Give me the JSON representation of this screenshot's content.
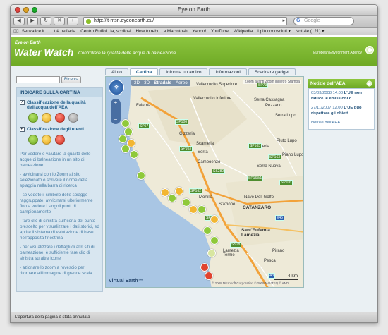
{
  "window": {
    "title": "Eye on Earth"
  },
  "toolbar": {
    "back": "◀",
    "forward": "▶",
    "reload": "↻",
    "stop": "✕",
    "add": "+",
    "url": "http://it-msn.eyeonearth.eu/",
    "search_placeholder": "Google"
  },
  "bookmarks": [
    "Senzalice.it",
    "... t è nell'aria",
    "Centro Ruffol...ia, scoliosi",
    "How to rebu...a Macintosh",
    "Yahoo!",
    "YouTube",
    "Wikipedia",
    "I più conosciuti ▾",
    "Notizie (121) ▾"
  ],
  "header": {
    "eyebrow": "Eye on Earth",
    "title": "Water Watch",
    "subtitle": "Controllare la qualità delle acque di balneazione",
    "agency": "European Environment Agency"
  },
  "tabs": [
    {
      "label": "Aiuto",
      "active": false
    },
    {
      "label": "Cartina",
      "active": true
    },
    {
      "label": "Informa un amico",
      "active": false
    },
    {
      "label": "Informazioni",
      "active": false
    },
    {
      "label": "Scaricare gadget",
      "active": false
    }
  ],
  "search": {
    "button": "Ricerca",
    "value": ""
  },
  "sidebar": {
    "heading": "INDICARE SULLA CARTINA",
    "check1": "Classificazione della qualità dell'acqua dell'AEA",
    "check2": "Classificazione degli utenti",
    "help": [
      "Per vedere e valutare la qualità delle acque di balneazione in un sito di balneazione:",
      "- avvicinarsi con lo Zoom al sito selezionato o scrivere il nome della spiaggia nella barra di ricerca",
      "- se vedete il simbolo delle spiagge raggruppate, avvicinarsi ulteriormente fino a vedere i singoli punti di campionamento",
      "- fare clic di sinistra sull'icona del punto prescelto per visualizzare i dati storici, ed aprire il sistema di valutazione di base nell'apposita finestrina",
      "- per visualizzare i dettagli di altri siti di balneazione, è sufficiente fare clic di sinistra su altre icone",
      "- azionare lo zoom a rovescio per ritornare all'immagine di grande scala"
    ]
  },
  "map": {
    "modes": [
      "2D",
      "3D",
      "Stradale",
      "Aereo"
    ],
    "selected_mode": "Stradale",
    "tiny_links": "Zoom avanti  Zoom indietro  Stampa",
    "labels": [
      {
        "text": "Falerna",
        "big": false
      },
      {
        "text": "Vallecrucito Superiore",
        "big": false
      },
      {
        "text": "Vallecrucito Inferiore",
        "big": false
      },
      {
        "text": "Serra Cassagna",
        "big": false
      },
      {
        "text": "Pezzano",
        "big": false
      },
      {
        "text": "Gizzeria",
        "big": false
      },
      {
        "text": "Scarnella",
        "big": false
      },
      {
        "text": "Serra",
        "big": false
      },
      {
        "text": "Seria",
        "big": false
      },
      {
        "text": "Campoenzo",
        "big": false
      },
      {
        "text": "Serra Nuova",
        "big": false
      },
      {
        "text": "Mortilla",
        "big": false
      },
      {
        "text": "Stazione",
        "big": false
      },
      {
        "text": "Nave Dell Golfo",
        "big": false
      },
      {
        "text": "CATANZARO",
        "big": true
      },
      {
        "text": "Sant'Eufemia Lamezia",
        "big": true
      },
      {
        "text": "Lamezia Terme",
        "big": false
      },
      {
        "text": "Pesca",
        "big": false
      },
      {
        "text": "Pirano",
        "big": false
      },
      {
        "text": "Pluto Lupo",
        "big": false
      },
      {
        "text": "Serra Lupo",
        "big": false
      },
      {
        "text": "Piano Lupo",
        "big": false
      }
    ],
    "roads": [
      "SP57",
      "SP73",
      "SP106",
      "SP103",
      "SP103",
      "SP163",
      "SS280",
      "SP163/1",
      "SP162",
      "SP106",
      "SP160",
      "SS18",
      "E45",
      "A3"
    ],
    "scale": "4 km",
    "brand": "Virtual Earth™",
    "copyright": "© 2008 Microsoft Corporation   © 2008 NAVTEQ   © AND"
  },
  "news": {
    "heading": "Notizie dell'AEA",
    "items": [
      {
        "date": "03/03/2008 14.00",
        "title": "L'UE non riduce le emissioni d..."
      },
      {
        "date": "27/11/2007 12.00",
        "title": "L'UE può rispettare gli obiett..."
      }
    ],
    "more": "Notizie dell'AEA..."
  },
  "status": "L'apertura della pagina è stata annullata"
}
